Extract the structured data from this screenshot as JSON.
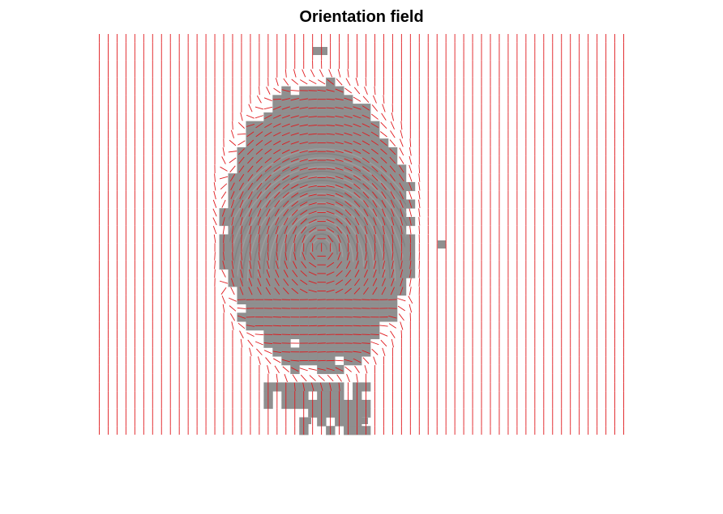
{
  "figure": {
    "title": "Orientation field"
  },
  "colors": {
    "field_lines": "#e0191d",
    "fingerprint_mask": "#8f8f8f",
    "ridge_dark": "#7a7a7a",
    "ridge_light": "#a8a8a8",
    "background": "#ffffff"
  },
  "orientation_field": {
    "columns": 60,
    "rows": 46,
    "uniform_direction": "vertical",
    "core": {
      "col": 25,
      "row": 24
    }
  }
}
